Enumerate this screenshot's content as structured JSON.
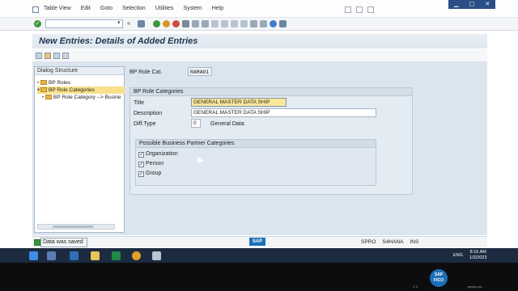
{
  "menu": {
    "items": [
      "Table View",
      "Edit",
      "Goto",
      "Selection",
      "Utilities",
      "System",
      "Help"
    ]
  },
  "toolbar": {
    "command_placeholder": "",
    "back_glyph": "«"
  },
  "window": {
    "title": "New Entries: Details of Added Entries"
  },
  "tree": {
    "header": "Dialog Structure",
    "nodes": [
      {
        "label": "BP Roles"
      },
      {
        "label": "BP Role Categories"
      },
      {
        "label": "BP Role Category --> Busine"
      }
    ]
  },
  "form": {
    "role_cat_label": "BP Role Cat.",
    "role_cat_value": "RAMA01",
    "group_title": "BP Role Categories",
    "title_label": "Title",
    "title_value": "GENERAL MASTER DATA SHIP",
    "description_label": "Description",
    "description_value": "GENERAL MASTER DATA SHIP",
    "difftype_label": "Diff.Type",
    "difftype_value": "0",
    "difftype_text": "General Data",
    "partner_group_title": "Possible Business Partner Categories",
    "checkboxes": [
      {
        "label": "Organization",
        "checked": true
      },
      {
        "label": "Person",
        "checked": true
      },
      {
        "label": "Group",
        "checked": true
      }
    ]
  },
  "status": {
    "message": "Data was saved",
    "sap_logo": "SAP",
    "spro": "SPRO",
    "system": "S4HANA",
    "mode": "INS"
  },
  "taskbar": {
    "lang": "ENG",
    "time": "8:16 AM",
    "date": "1/2/2023"
  },
  "overlay": {
    "badge_line1": "SAP",
    "badge_line2": "FICO",
    "left_label": "V C",
    "right_label": "pavan pol"
  },
  "colors": {
    "title_bar": "#dfe6ee",
    "main_bg": "#dbe5ef",
    "focus_field": "#fde79a",
    "taskbar": "#1c2b3f",
    "sap_blue": "#1b6fb8"
  }
}
